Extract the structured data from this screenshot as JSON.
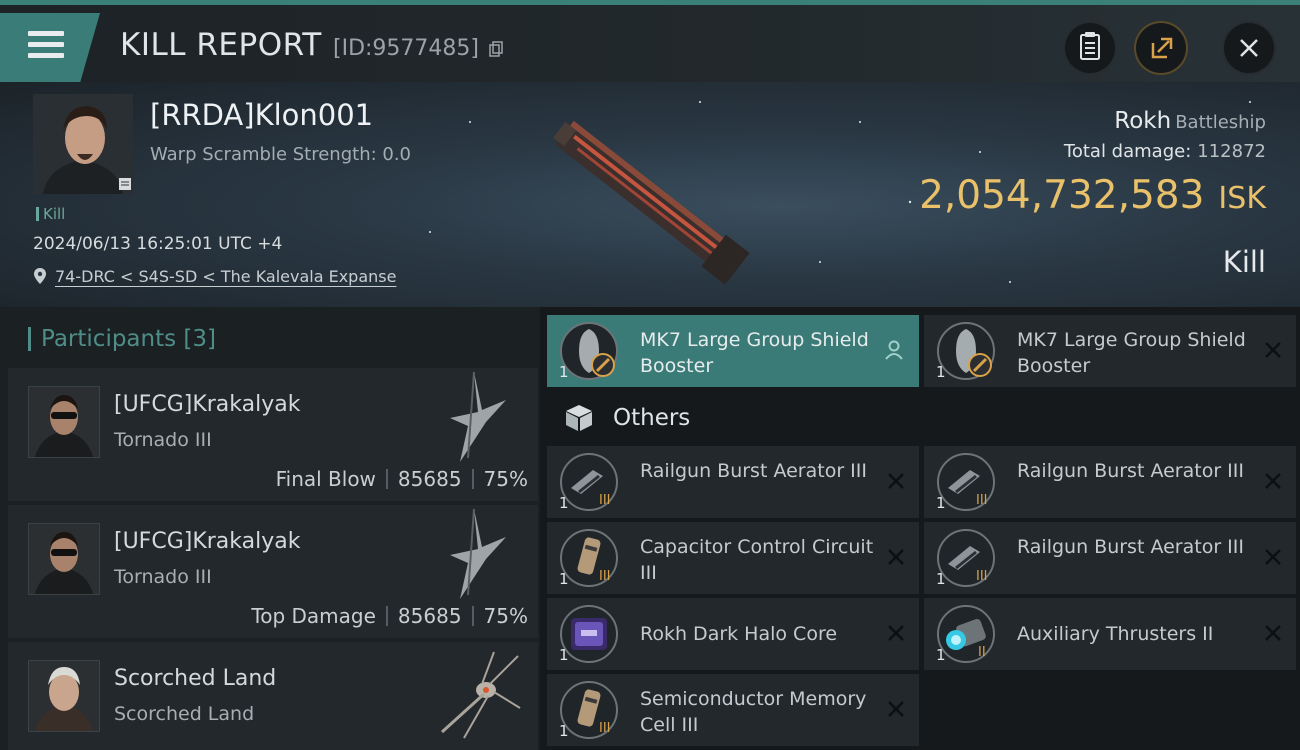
{
  "header": {
    "title": "KILL REPORT",
    "kill_id": "[ID:9577485]",
    "pilot_name": "[RRDA]Klon001",
    "warp_scramble": "Warp Scramble Strength: 0.0",
    "kill_tag": "Kill",
    "datetime": "2024/06/13 16:25:01 UTC +4",
    "location": "74-DRC < S4S-SD < The Kalevala Expanse",
    "ship_name": "Rokh",
    "ship_class": "Battleship",
    "total_damage_label": "Total damage:",
    "total_damage": "112872",
    "isk_value": "2,054,732,583",
    "isk_unit": "ISK",
    "result": "Kill"
  },
  "participants": {
    "label": "Participants",
    "count": "[3]",
    "items": [
      {
        "name": "[UFCG]Krakalyak",
        "ship": "Tornado III",
        "role": "Final Blow",
        "damage": "85685",
        "percent": "75%"
      },
      {
        "name": "[UFCG]Krakalyak",
        "ship": "Tornado III",
        "role": "Top Damage",
        "damage": "85685",
        "percent": "75%"
      },
      {
        "name": "Scorched Land",
        "ship": "Scorched Land"
      }
    ]
  },
  "modules": {
    "top": [
      {
        "qty": "1",
        "name": "MK7 Large Group Shield Booster"
      },
      {
        "qty": "1",
        "name": "MK7 Large Group Shield Booster"
      }
    ],
    "others_label": "Others",
    "others": [
      {
        "qty": "1",
        "name": "Railgun Burst Aerator III"
      },
      {
        "qty": "1",
        "name": "Railgun Burst Aerator III"
      },
      {
        "qty": "1",
        "name": "Capacitor Control Circuit III"
      },
      {
        "qty": "1",
        "name": "Railgun Burst Aerator III"
      },
      {
        "qty": "1",
        "name": "Rokh Dark Halo Core"
      },
      {
        "qty": "1",
        "name": "Auxiliary Thrusters II"
      },
      {
        "qty": "1",
        "name": "Semiconductor Memory Cell III"
      }
    ]
  },
  "colors": {
    "accent": "#3b7b77",
    "isk": "#e8c16a",
    "panel": "#22282c"
  }
}
